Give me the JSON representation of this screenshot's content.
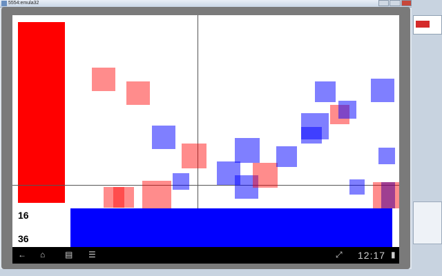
{
  "window": {
    "title": "5554:emula32"
  },
  "navbar": {
    "time": "12:17",
    "icons": [
      "back-icon",
      "home-icon",
      "recent-apps-icon",
      "menu-icon",
      "fullscreen-icon",
      "battery-icon"
    ]
  },
  "app": {
    "counter_top": "16",
    "counter_bottom": "36",
    "colors": {
      "red": "#ff0000",
      "blue": "#0000ff"
    },
    "squares": [
      {
        "color": "red"
      },
      {
        "color": "red"
      },
      {
        "color": "blue"
      },
      {
        "color": "red"
      },
      {
        "color": "blue"
      },
      {
        "color": "red"
      },
      {
        "color": "red"
      },
      {
        "color": "blue"
      },
      {
        "color": "blue"
      },
      {
        "color": "blue"
      },
      {
        "color": "red"
      },
      {
        "color": "blue"
      },
      {
        "color": "blue"
      },
      {
        "color": "blue"
      },
      {
        "color": "red"
      },
      {
        "color": "blue"
      },
      {
        "color": "blue"
      },
      {
        "color": "blue"
      },
      {
        "color": "blue"
      },
      {
        "color": "red"
      },
      {
        "color": "blue"
      },
      {
        "color": "blue"
      },
      {
        "color": "red"
      }
    ]
  }
}
